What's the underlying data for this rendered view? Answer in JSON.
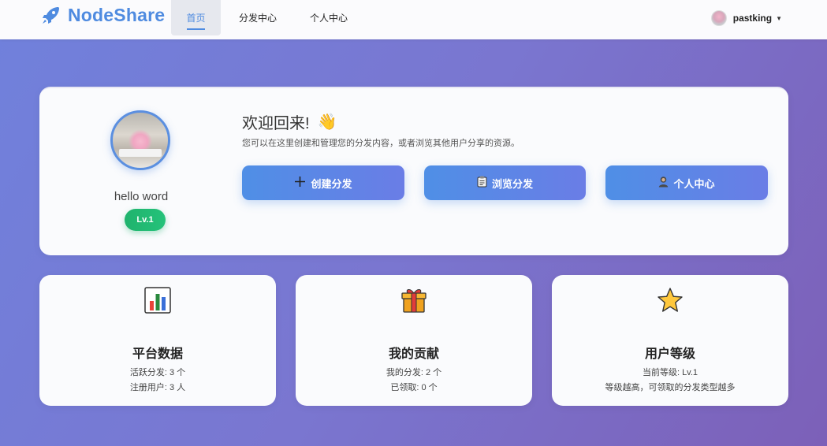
{
  "navbar": {
    "brand": "NodeShare",
    "items": [
      {
        "label": "首页",
        "active": true
      },
      {
        "label": "分发中心",
        "active": false
      },
      {
        "label": "个人中心",
        "active": false
      }
    ],
    "username": "pastking",
    "brand_color": "#4f8be0"
  },
  "welcome": {
    "display_name": "hello word",
    "level": "Lv.1",
    "title": "欢迎回来!",
    "wave_icon": "👋",
    "subtitle": "您可以在这里创建和管理您的分发内容，或者浏览其他用户分享的资源。",
    "buttons": [
      {
        "label": "创建分发",
        "icon": "plus-icon"
      },
      {
        "label": "浏览分发",
        "icon": "clipboard-icon"
      },
      {
        "label": "个人中心",
        "icon": "user-icon"
      }
    ]
  },
  "stats": [
    {
      "icon": "bar-chart-icon",
      "title": "平台数据",
      "lines": [
        "活跃分发: 3 个",
        "注册用户: 3 人"
      ]
    },
    {
      "icon": "gift-icon",
      "title": "我的贡献",
      "lines": [
        "我的分发: 2 个",
        "已领取: 0 个"
      ]
    },
    {
      "icon": "star-icon",
      "title": "用户等级",
      "lines": [
        "当前等级: Lv.1",
        "等级越高，可领取的分发类型越多"
      ]
    }
  ],
  "colors": {
    "accent": "#4f8be0",
    "level_badge": "#1fb36d"
  }
}
